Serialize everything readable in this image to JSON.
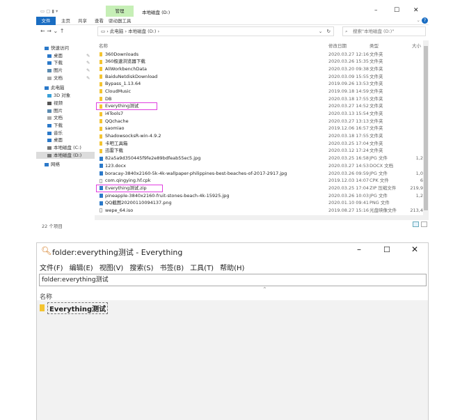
{
  "explorer": {
    "quick_access": [
      "管理",
      "本地磁盘 (D:)"
    ],
    "ribbon_tabs": [
      "文件",
      "主页",
      "共享",
      "查看",
      "驱动器工具"
    ],
    "path": [
      "此电脑",
      "本地磁盘 (D:)"
    ],
    "search_placeholder": "搜索\"本地磁盘 (D:)\"",
    "columns": {
      "name": "名称",
      "date": "修改日期",
      "type": "类型",
      "size": "大小"
    },
    "nav": [
      {
        "label": "快速访问",
        "icon": "star-icon",
        "color": "#2b79c9",
        "indent": 0
      },
      {
        "label": "桌面",
        "icon": "desktop-icon",
        "color": "#2b79c9",
        "indent": 1,
        "pin": true
      },
      {
        "label": "下载",
        "icon": "download-icon",
        "color": "#2b79c9",
        "indent": 1,
        "pin": true
      },
      {
        "label": "图片",
        "icon": "pictures-icon",
        "color": "#5a8ab0",
        "indent": 1,
        "pin": true
      },
      {
        "label": "文档",
        "icon": "document-icon",
        "color": "#aaa",
        "indent": 1,
        "pin": true
      },
      {
        "label": "此电脑",
        "icon": "computer-icon",
        "color": "#2b79c9",
        "indent": 0
      },
      {
        "label": "3D 对象",
        "icon": "3d-objects-icon",
        "color": "#3aa0d8",
        "indent": 1
      },
      {
        "label": "视频",
        "icon": "video-icon",
        "color": "#555",
        "indent": 1
      },
      {
        "label": "图片",
        "icon": "pictures-icon",
        "color": "#5a8ab0",
        "indent": 1
      },
      {
        "label": "文档",
        "icon": "document-icon",
        "color": "#aaa",
        "indent": 1
      },
      {
        "label": "下载",
        "icon": "download-icon",
        "color": "#2b79c9",
        "indent": 1
      },
      {
        "label": "音乐",
        "icon": "music-icon",
        "color": "#2b79c9",
        "indent": 1
      },
      {
        "label": "桌面",
        "icon": "desktop-icon",
        "color": "#2b79c9",
        "indent": 1
      },
      {
        "label": "本地磁盘 (C:)",
        "icon": "drive-icon",
        "color": "#777",
        "indent": 1
      },
      {
        "label": "本地磁盘 (D:)",
        "icon": "drive-icon",
        "color": "#777",
        "indent": 1,
        "selected": true
      },
      {
        "label": "网络",
        "icon": "network-icon",
        "color": "#2b79c9",
        "indent": 0
      }
    ],
    "files": [
      {
        "name": "360Downloads",
        "date": "2020.03.27 12:16",
        "type": "文件夹",
        "size": "",
        "kind": "folder"
      },
      {
        "name": "360极速浏览器下载",
        "date": "2020.03.26 15:35",
        "type": "文件夹",
        "size": "",
        "kind": "folder"
      },
      {
        "name": "AliWorkbenchData",
        "date": "2020.03.20 09:38",
        "type": "文件夹",
        "size": "",
        "kind": "folder"
      },
      {
        "name": "BaiduNetdiskDownload",
        "date": "2020.03.09 15:55",
        "type": "文件夹",
        "size": "",
        "kind": "folder"
      },
      {
        "name": "Bypass_1.13.64",
        "date": "2019.09.26 13:53",
        "type": "文件夹",
        "size": "",
        "kind": "folder"
      },
      {
        "name": "CloudMusic",
        "date": "2019.09.18 14:59",
        "type": "文件夹",
        "size": "",
        "kind": "folder"
      },
      {
        "name": "DB",
        "date": "2020.03.18 17:55",
        "type": "文件夹",
        "size": "",
        "kind": "folder"
      },
      {
        "name": "Everything测试",
        "date": "2020.03.27 14:52",
        "type": "文件夹",
        "size": "",
        "kind": "folder",
        "highlight": true
      },
      {
        "name": "i4Tools7",
        "date": "2020.03.13 15:54",
        "type": "文件夹",
        "size": "",
        "kind": "folder"
      },
      {
        "name": "QQchache",
        "date": "2020.03.27 13:13",
        "type": "文件夹",
        "size": "",
        "kind": "folder"
      },
      {
        "name": "saomiao",
        "date": "2019.12.06 16:57",
        "type": "文件夹",
        "size": "",
        "kind": "folder"
      },
      {
        "name": "ShadowsocksR-win-4.9.2",
        "date": "2020.03.18 17:55",
        "type": "文件夹",
        "size": "",
        "kind": "folder"
      },
      {
        "name": "卡吧工具箱",
        "date": "2020.03.25 17:04",
        "type": "文件夹",
        "size": "",
        "kind": "folder"
      },
      {
        "name": "迅雷下载",
        "date": "2020.03.12 17:24",
        "type": "文件夹",
        "size": "",
        "kind": "folder"
      },
      {
        "name": "82a5a9d350445f9fe2e89bdfeab55ec5.jpg",
        "date": "2020.03.25 16:58",
        "type": "JPG 文件",
        "size": "1,2",
        "kind": "file"
      },
      {
        "name": "123.docx",
        "date": "2020.03.27 14:53",
        "type": "DOCX 文档",
        "size": "",
        "kind": "file"
      },
      {
        "name": "boracay-3840x2160-5k-4k-wallpaper-philippines-best-beaches-of-2017-2917.jpg",
        "date": "2020.03.26 09:59",
        "type": "JPG 文件",
        "size": "1,0",
        "kind": "file"
      },
      {
        "name": "com.qingying.hf.cpk",
        "date": "2019.12.03 14:07",
        "type": "CPK 文件",
        "size": "6",
        "kind": "plain"
      },
      {
        "name": "Everything测试.zip",
        "date": "2020.03.25 17:04",
        "type": "ZIP 压缩文件",
        "size": "219,9",
        "kind": "file",
        "highlight": true
      },
      {
        "name": "pineapple-3840x2160-fruit-stones-beach-4k-15925.jpg",
        "date": "2020.03.26 10:03",
        "type": "JPG 文件",
        "size": "1,2",
        "kind": "file"
      },
      {
        "name": "QQ截图20200110094137.png",
        "date": "2020.01.10 09:41",
        "type": "PNG 文件",
        "size": "",
        "kind": "file"
      },
      {
        "name": "wepe_64.iso",
        "date": "2019.08.27 15:16",
        "type": "光盘映像文件",
        "size": "213,4",
        "kind": "plain"
      }
    ],
    "status": "22 个项目"
  },
  "everything": {
    "title": "folder:everything测试 - Everything",
    "menu": [
      "文件(F)",
      "编辑(E)",
      "视图(V)",
      "搜索(S)",
      "书签(B)",
      "工具(T)",
      "帮助(H)"
    ],
    "search_value": "folder:everything测试",
    "column_name": "名称",
    "results": [
      "Everything测试"
    ]
  }
}
